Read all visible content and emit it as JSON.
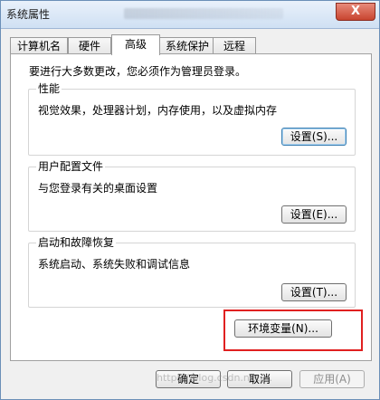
{
  "window": {
    "title": "系统属性",
    "close_label": "X"
  },
  "tabs": [
    {
      "label": "计算机名"
    },
    {
      "label": "硬件"
    },
    {
      "label": "高级",
      "active": true
    },
    {
      "label": "系统保护"
    },
    {
      "label": "远程"
    }
  ],
  "panel": {
    "admin_note": "要进行大多数更改，您必须作为管理员登录。",
    "performance": {
      "title": "性能",
      "description": "视觉效果，处理器计划，内存使用，以及虚拟内存",
      "button": "设置(S)..."
    },
    "user_profiles": {
      "title": "用户配置文件",
      "description": "与您登录有关的桌面设置",
      "button": "设置(E)..."
    },
    "startup_recovery": {
      "title": "启动和故障恢复",
      "description": "系统启动、系统失败和调试信息",
      "button": "设置(T)..."
    },
    "env_button": "环境变量(N)..."
  },
  "footer": {
    "ok": "确定",
    "cancel": "取消",
    "apply": "应用(A)"
  },
  "watermark": "https://blog.csdn.net/..."
}
